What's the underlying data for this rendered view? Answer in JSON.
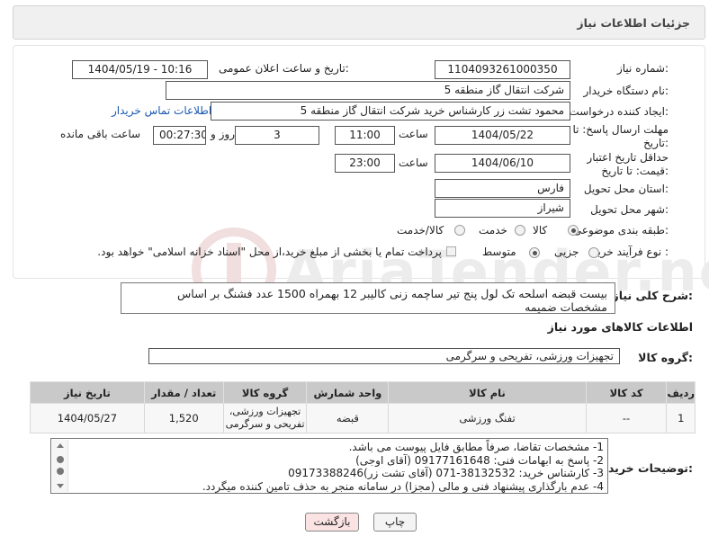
{
  "header": {
    "title": "جزئیات اطلاعات نیاز"
  },
  "form": {
    "need_number_label": "شماره نیاز:",
    "need_number": "1104093261000350",
    "announce_label": "تاریخ و ساعت اعلان عمومی:",
    "announce_value": "1404/05/19 - 10:16",
    "buyer_org_label": "نام دستگاه خریدار:",
    "buyer_org": "شرکت انتقال گاز منطقه 5",
    "creator_label": "ایجاد کننده درخواست:",
    "creator": "محمود تشت زر کارشناس خرید شرکت انتقال گاز منطقه 5",
    "contact_link": "اطلاعات تماس خریدار",
    "reply_deadline_label": "مهلت ارسال پاسخ: تا تاریخ:",
    "reply_date": "1404/05/22",
    "time_label": "ساعت",
    "reply_time": "11:00",
    "days_value": "3",
    "days_label": "روز و",
    "remaining_time": "00:27:30",
    "remaining_label": "ساعت باقی مانده",
    "price_validity_label": "حداقل تاریخ اعتبار قیمت: تا تاریخ:",
    "validity_date": "1404/06/10",
    "validity_time": "23:00",
    "province_label": "استان محل تحویل:",
    "province": "فارس",
    "city_label": "شهر محل تحویل:",
    "city": "شیراز",
    "category_label": "طبقه بندی موضوعی:",
    "category_options": [
      "کالا",
      "خدمت",
      "کالا/خدمت"
    ],
    "process_label": "نوع فرآیند خرید :",
    "process_options": [
      "جزیی",
      "متوسط"
    ],
    "payment_note": "پرداخت تمام یا بخشی از مبلغ خرید،از محل \"اسناد خزانه اسلامی\" خواهد بود."
  },
  "description": {
    "label": "شرح کلی نیاز:",
    "text": "بیست قبضه اسلحه تک لول پنج تیر ساچمه زنی کالیبر 12 بهمراه 1500 عدد فشنگ بر اساس مشخصات ضمیمه"
  },
  "goods": {
    "section_title": "اطلاعات کالاهای مورد نیاز",
    "group_label": "گروه کالا:",
    "group_value": "تجهیزات ورزشی، تفریحی و سرگرمی",
    "columns": [
      "ردیف",
      "کد کالا",
      "نام کالا",
      "واحد شمارش",
      "گروه کالا",
      "تعداد / مقدار",
      "تاریخ نیاز"
    ],
    "rows": [
      {
        "row": "1",
        "code": "--",
        "name": "تفنگ ورزشی",
        "unit": "قبضه",
        "group": "تجهیزات ورزشی، تفریحی و سرگرمی",
        "qty": "1,520",
        "date": "1404/05/27"
      }
    ]
  },
  "notes": {
    "label": "توضیحات خریدار:",
    "lines": [
      "1-  مشخصات تقاضا، صرفاً مطابق فایل پیوست می باشد.",
      "2- پاسخ به ابهامات فنی: 09177161648 (آقای اوجی)",
      "3- کارشناس خرید: 38132532-071 (آقای تشت زر)09173388246",
      "4- عدم بارگذاری پیشنهاد فنی و مالی (مجزا) در سامانه منجر به حذف تامین کننده میگردد."
    ]
  },
  "buttons": {
    "print": "چاپ",
    "back": "بازگشت"
  },
  "watermark": {
    "text": "AriaTender.neT"
  },
  "colors": {
    "link": "#1a58b0",
    "back_button": "#fbe3e3",
    "table_header": "#c9c9c9"
  }
}
